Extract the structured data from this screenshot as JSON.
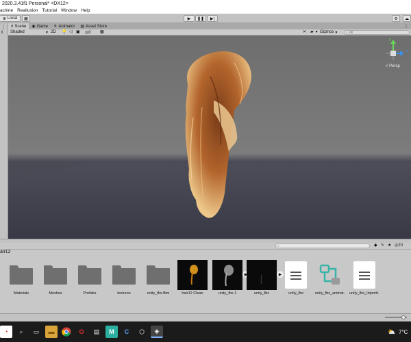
{
  "window": {
    "title": "2020.3.41f1 Personal* <DX12>"
  },
  "menu": [
    "achine",
    "Reallusion",
    "Tutorial",
    "Window",
    "Help"
  ],
  "toolbar": {
    "local_label": "Local"
  },
  "tabs": [
    {
      "label": "Scene",
      "icon": "scene-icon"
    },
    {
      "label": "Game",
      "icon": "game-icon"
    },
    {
      "label": "Animator",
      "icon": "animator-icon"
    },
    {
      "label": "Asset Store",
      "icon": "store-icon"
    }
  ],
  "scene_toolbar": {
    "shading_mode": "Shaded",
    "dimension": "2D",
    "gizmo_count": "0",
    "gizmos_label": "Gizmos",
    "search_placeholder": "All"
  },
  "viewport": {
    "persp_label": "< Persp",
    "axis_y": "y",
    "axis_z": "z"
  },
  "project": {
    "breadcrumb": "air12",
    "hidden_count": "20",
    "assets": [
      {
        "label": "Materials",
        "type": "folder"
      },
      {
        "label": "Meshes",
        "type": "folder"
      },
      {
        "label": "Prefabs",
        "type": "folder"
      },
      {
        "label": "textures",
        "type": "folder"
      },
      {
        "label": "unity_fbx.fbm",
        "type": "folder"
      },
      {
        "label": "hair12 Clean",
        "type": "model"
      },
      {
        "label": "unity_fbx 1",
        "type": "model"
      },
      {
        "label": "unity_fbx",
        "type": "model"
      },
      {
        "label": "unity_fbx",
        "type": "document"
      },
      {
        "label": "unity_fbx_animat...",
        "type": "animator"
      },
      {
        "label": "unity_fbx_Importi...",
        "type": "document"
      }
    ]
  },
  "taskbar": {
    "temperature": "7°C"
  },
  "colors": {
    "accent": "#3d8ee6",
    "viewport_sky": "#777777",
    "viewport_ground": "#41424e",
    "hair": "#b5652a"
  }
}
